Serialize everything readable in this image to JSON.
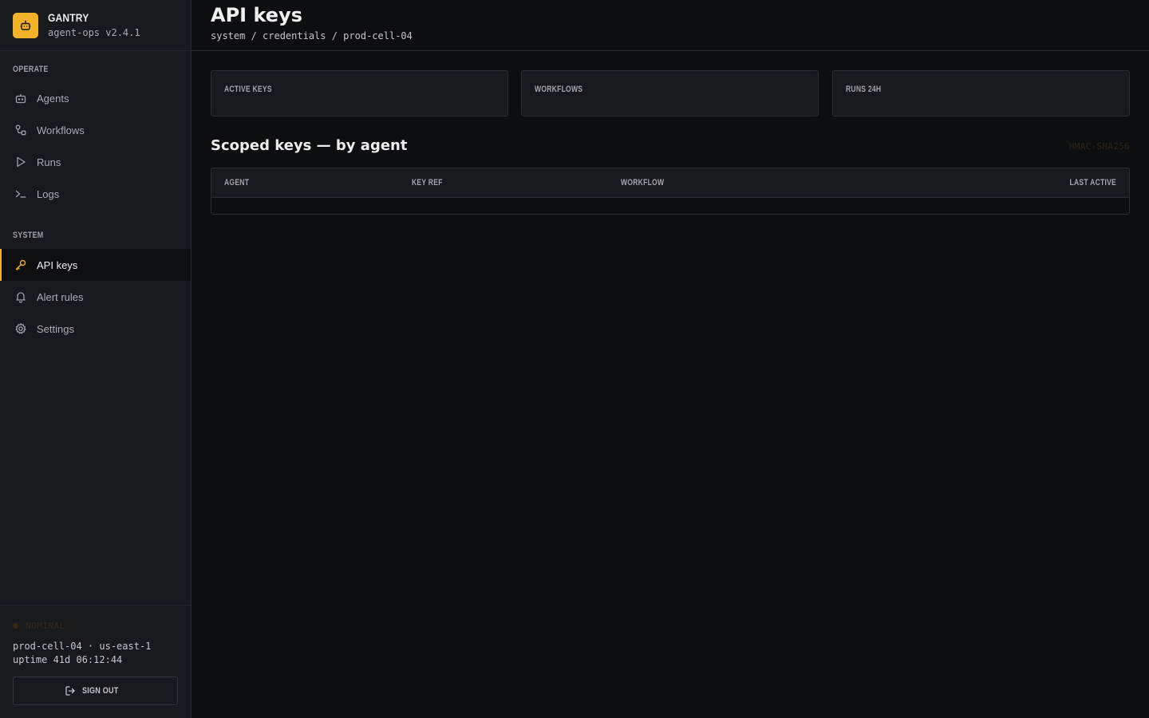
{
  "brand": {
    "name": "GANTRY",
    "version": "agent-ops v2.4.1",
    "accent": "#f4b228"
  },
  "sidebar": {
    "sections": [
      {
        "label": "OPERATE",
        "items": [
          {
            "label": "Agents",
            "icon": "robot-icon"
          },
          {
            "label": "Workflows",
            "icon": "workflow-icon"
          },
          {
            "label": "Runs",
            "icon": "play-icon"
          },
          {
            "label": "Logs",
            "icon": "terminal-icon"
          }
        ]
      },
      {
        "label": "SYSTEM",
        "items": [
          {
            "label": "API keys",
            "icon": "key-icon",
            "active": true
          },
          {
            "label": "Alert rules",
            "icon": "bell-icon"
          },
          {
            "label": "Settings",
            "icon": "gear-icon"
          }
        ]
      }
    ],
    "footer": {
      "status": "NOMINAL",
      "cell": "prod-cell-04 · us-east-1",
      "uptime": "uptime 41d 06:12:44",
      "signout_label": "SIGN OUT"
    }
  },
  "header": {
    "title": "API keys",
    "breadcrumb": "system / credentials / prod-cell-04"
  },
  "stats": [
    {
      "label": "ACTIVE KEYS"
    },
    {
      "label": "WORKFLOWS"
    },
    {
      "label": "RUNS 24H"
    }
  ],
  "keys_section": {
    "title": "Scoped keys — by agent",
    "algorithm": "HMAC-SHA256",
    "columns": [
      "AGENT",
      "KEY REF",
      "WORKFLOW",
      "LAST ACTIVE"
    ],
    "rows": []
  }
}
